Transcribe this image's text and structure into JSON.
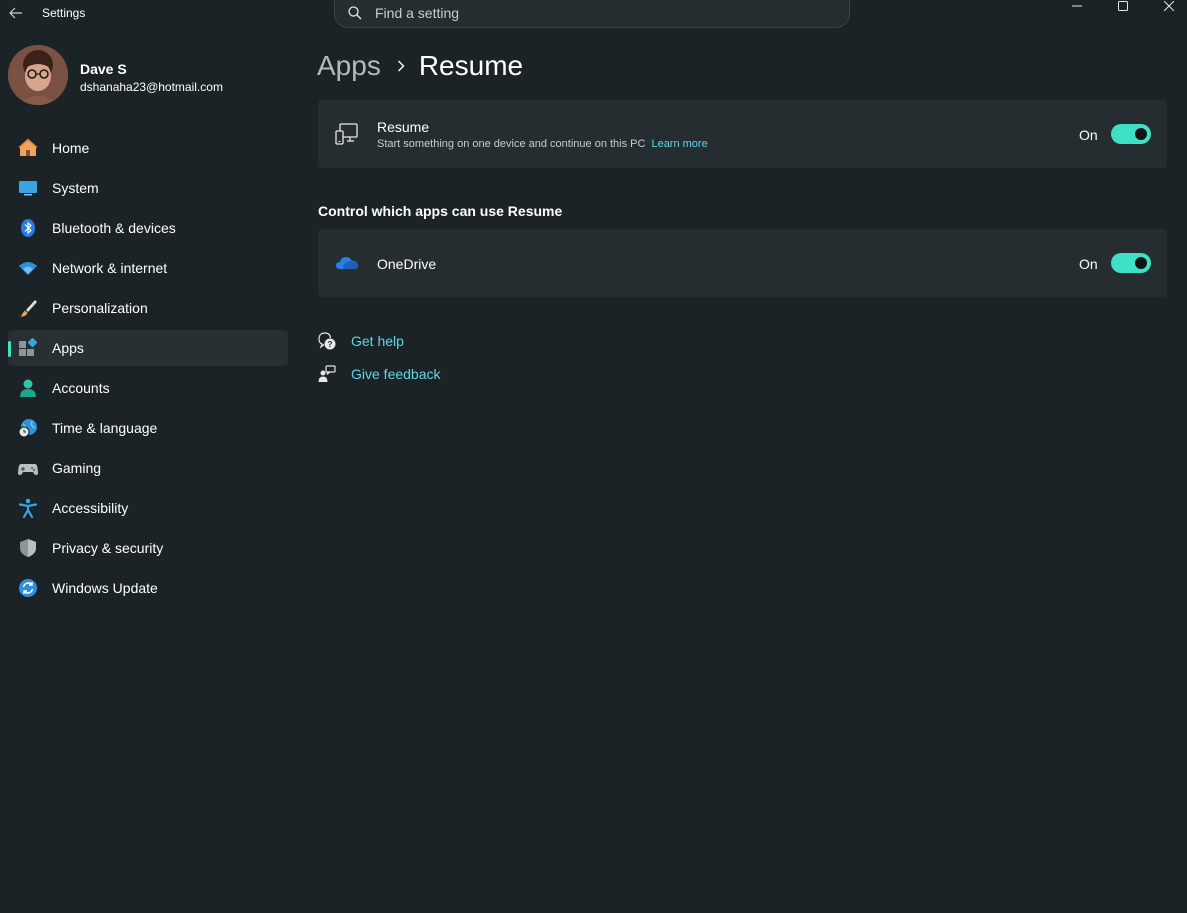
{
  "window": {
    "title": "Settings",
    "search_placeholder": "Find a setting"
  },
  "profile": {
    "name": "Dave S",
    "email": "dshanaha23@hotmail.com"
  },
  "sidebar": {
    "items": [
      {
        "label": "Home",
        "icon": "home-icon",
        "active": false
      },
      {
        "label": "System",
        "icon": "system-icon",
        "active": false
      },
      {
        "label": "Bluetooth & devices",
        "icon": "bluetooth-icon",
        "active": false
      },
      {
        "label": "Network & internet",
        "icon": "wifi-icon",
        "active": false
      },
      {
        "label": "Personalization",
        "icon": "brush-icon",
        "active": false
      },
      {
        "label": "Apps",
        "icon": "apps-icon",
        "active": true
      },
      {
        "label": "Accounts",
        "icon": "person-icon",
        "active": false
      },
      {
        "label": "Time & language",
        "icon": "globe-clock-icon",
        "active": false
      },
      {
        "label": "Gaming",
        "icon": "gamepad-icon",
        "active": false
      },
      {
        "label": "Accessibility",
        "icon": "accessibility-icon",
        "active": false
      },
      {
        "label": "Privacy & security",
        "icon": "shield-icon",
        "active": false
      },
      {
        "label": "Windows Update",
        "icon": "update-icon",
        "active": false
      }
    ]
  },
  "breadcrumb": {
    "parent": "Apps",
    "current": "Resume"
  },
  "resume_card": {
    "title": "Resume",
    "subtitle": "Start something on one device and continue on this PC",
    "link": "Learn more",
    "state": "On"
  },
  "section": {
    "title": "Control which apps can use Resume"
  },
  "onedrive_card": {
    "title": "OneDrive",
    "state": "On"
  },
  "help": {
    "get_help": "Get help",
    "give_feedback": "Give feedback"
  },
  "colors": {
    "accent": "#3fe0c5",
    "link": "#5ed8e6",
    "background": "#1b2326",
    "card": "#252d30"
  }
}
